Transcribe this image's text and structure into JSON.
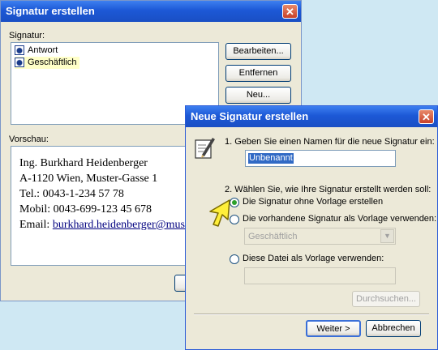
{
  "back_dialog": {
    "title": "Signatur erstellen",
    "signature_label": "Signatur:",
    "signatures": [
      "Antwort",
      "Geschäftlich"
    ],
    "buttons": {
      "edit": "Bearbeiten...",
      "remove": "Entfernen",
      "new": "Neu..."
    },
    "preview_label": "Vorschau:",
    "preview_lines": [
      "Ing. Burkhard Heidenberger",
      "A-1120 Wien, Muster-Gasse 1",
      "Tel.: 0043-1-234 57 78",
      "Mobil: 0043-699-123 45 678"
    ],
    "preview_email_prefix": "Email: ",
    "preview_email": "burkhard.heidenberger@muste"
  },
  "front_dialog": {
    "title": "Neue Signatur erstellen",
    "step1": "1. Geben Sie einen Namen für die neue Signatur ein:",
    "name_value": "Unbenannt",
    "step2": "2. Wählen Sie, wie Ihre Signatur erstellt werden soll:",
    "option1": "Die Signatur ohne Vorlage erstellen",
    "option2": "Die vorhandene Signatur als Vorlage verwenden:",
    "template_select": "Geschäftlich",
    "option3": "Diese Datei als Vorlage verwenden:",
    "file_value": "",
    "browse": "Durchsuchen...",
    "next": "Weiter >",
    "cancel": "Abbrechen"
  },
  "icons": {
    "close": "close-icon",
    "wizard": "signature-pen-icon",
    "cursor": "arrow-cursor-icon",
    "dropdown": "chevron-down-icon"
  },
  "colors": {
    "titlebar": "#1c58d6",
    "dialog_bg": "#ece9d8",
    "desktop": "#cfe8f3",
    "list_selected": "#ffffc8"
  }
}
